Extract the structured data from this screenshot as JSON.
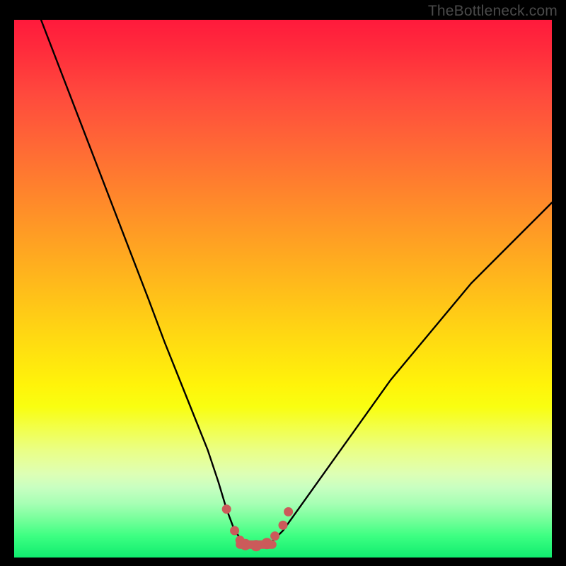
{
  "watermark": "TheBottleneck.com",
  "chart_data": {
    "type": "line",
    "title": "",
    "xlabel": "",
    "ylabel": "",
    "xlim": [
      0,
      100
    ],
    "ylim": [
      0,
      100
    ],
    "grid": false,
    "series": [
      {
        "name": "bottleneck-curve",
        "x": [
          5,
          10,
          15,
          20,
          25,
          28,
          30,
          32,
          34,
          36,
          38,
          39.5,
          41,
          42.5,
          44,
          46,
          48,
          50,
          55,
          60,
          65,
          70,
          75,
          80,
          85,
          90,
          95,
          100
        ],
        "values": [
          100,
          87,
          74,
          61,
          48,
          40,
          35,
          30,
          25,
          20,
          14,
          9,
          5,
          3,
          2.2,
          2.2,
          3,
          5,
          12,
          19,
          26,
          33,
          39,
          45,
          51,
          56,
          61,
          66
        ]
      }
    ],
    "markers": {
      "name": "highlight-points",
      "color": "#cb5a5a",
      "radius_small": 6.5,
      "radius_large": 8,
      "points": [
        {
          "x": 39.5,
          "y": 9,
          "r": "small"
        },
        {
          "x": 41,
          "y": 5,
          "r": "small"
        },
        {
          "x": 42,
          "y": 3.2,
          "r": "small"
        },
        {
          "x": 43,
          "y": 2.4,
          "r": "large"
        },
        {
          "x": 45,
          "y": 2.2,
          "r": "large"
        },
        {
          "x": 47,
          "y": 2.6,
          "r": "large"
        },
        {
          "x": 48.5,
          "y": 4,
          "r": "small"
        },
        {
          "x": 50,
          "y": 6,
          "r": "small"
        },
        {
          "x": 51,
          "y": 8.5,
          "r": "small"
        }
      ]
    },
    "flat_segment": {
      "name": "flat-bottom",
      "color": "#cb5a5a",
      "y": 2.4,
      "x_start": 42,
      "x_end": 48,
      "thickness": 12
    }
  }
}
